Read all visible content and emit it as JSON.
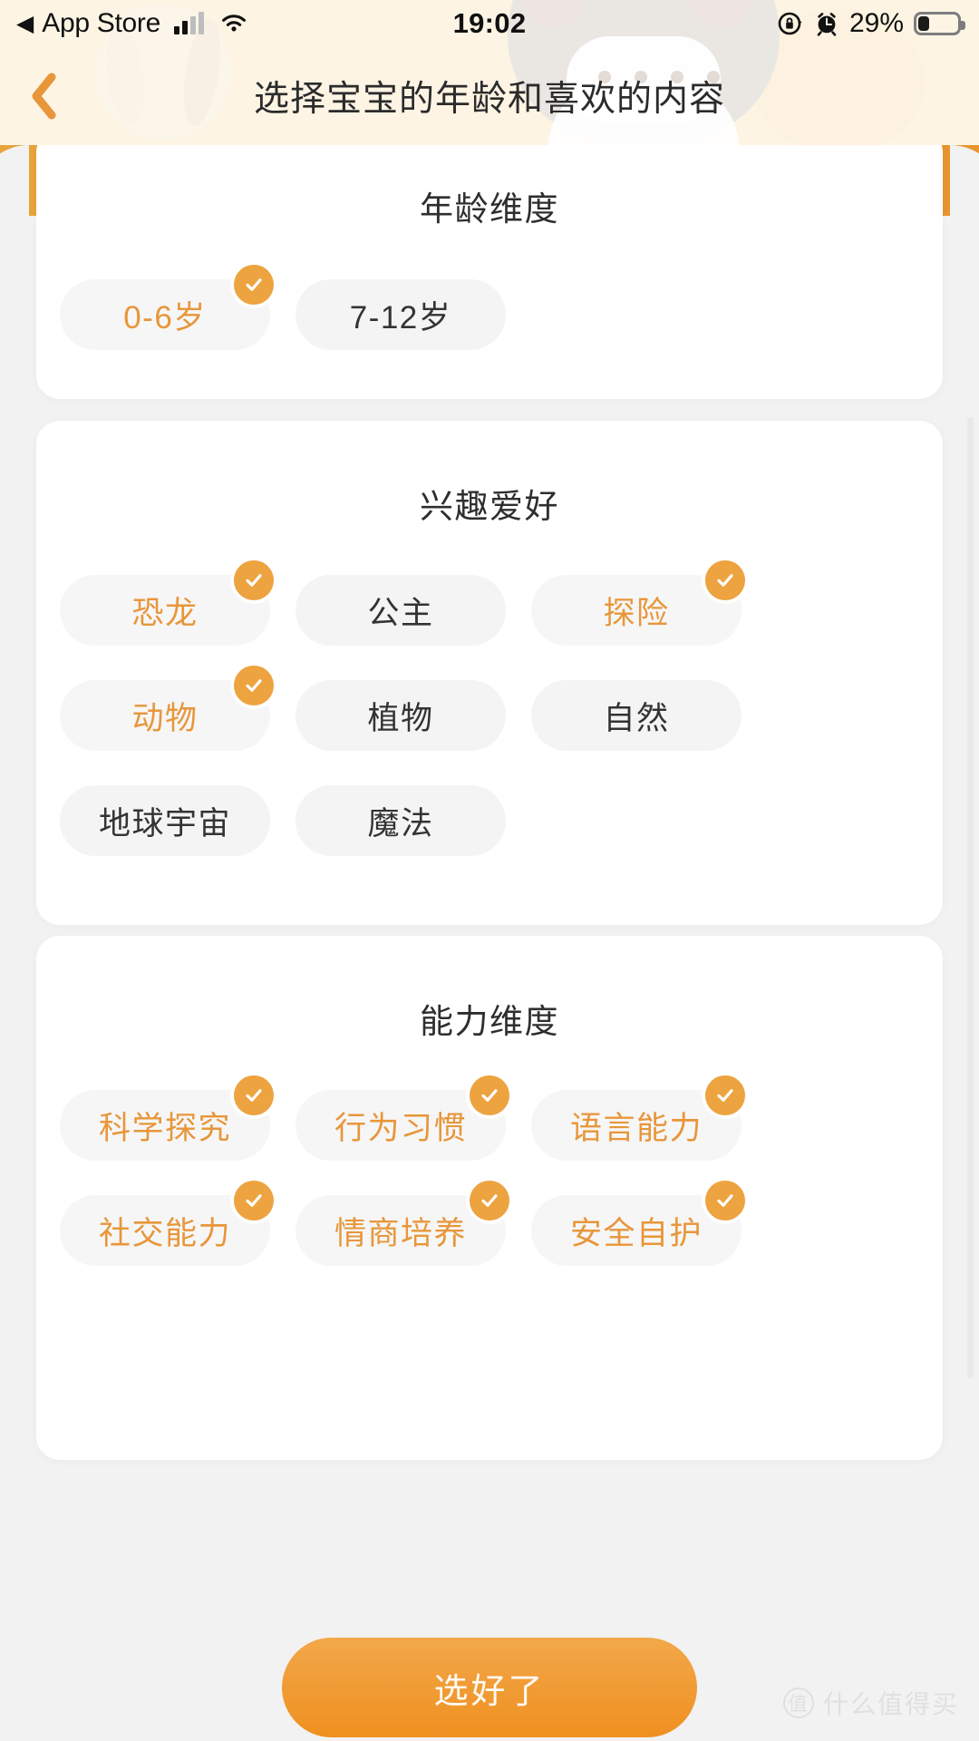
{
  "status_bar": {
    "back_glyph": "◀",
    "carrier_app": "App Store",
    "time": "19:02",
    "battery_percent": "29%",
    "icons": [
      "signal-bars-icon",
      "wifi-icon",
      "rotation-lock-icon",
      "alarm-clock-icon",
      "battery-icon"
    ]
  },
  "nav": {
    "back_label": "‹",
    "title": "选择宝宝的年龄和喜欢的内容"
  },
  "colors": {
    "accent": "#e8963a",
    "header_bg": "#fdf4e4",
    "page_bg": "#f2f2f2",
    "card_bg": "#ffffff",
    "chip_bg": "#f4f4f4",
    "badge": "#eda33f"
  },
  "sections": [
    {
      "id": "age",
      "title": "年龄维度",
      "options": [
        {
          "label": "0-6岁",
          "selected": true
        },
        {
          "label": "7-12岁",
          "selected": false
        }
      ]
    },
    {
      "id": "interests",
      "title": "兴趣爱好",
      "options": [
        {
          "label": "恐龙",
          "selected": true
        },
        {
          "label": "公主",
          "selected": false
        },
        {
          "label": "探险",
          "selected": true
        },
        {
          "label": "动物",
          "selected": true
        },
        {
          "label": "植物",
          "selected": false
        },
        {
          "label": "自然",
          "selected": false
        },
        {
          "label": "地球宇宙",
          "selected": false
        },
        {
          "label": "魔法",
          "selected": false
        }
      ]
    },
    {
      "id": "ability",
      "title": "能力维度",
      "options": [
        {
          "label": "科学探究",
          "selected": true
        },
        {
          "label": "行为习惯",
          "selected": true
        },
        {
          "label": "语言能力",
          "selected": true
        },
        {
          "label": "社交能力",
          "selected": true
        },
        {
          "label": "情商培养",
          "selected": true
        },
        {
          "label": "安全自护",
          "selected": true
        }
      ]
    }
  ],
  "cta": {
    "label": "选好了"
  },
  "watermark": {
    "mark": "值",
    "text": "什么值得买"
  }
}
